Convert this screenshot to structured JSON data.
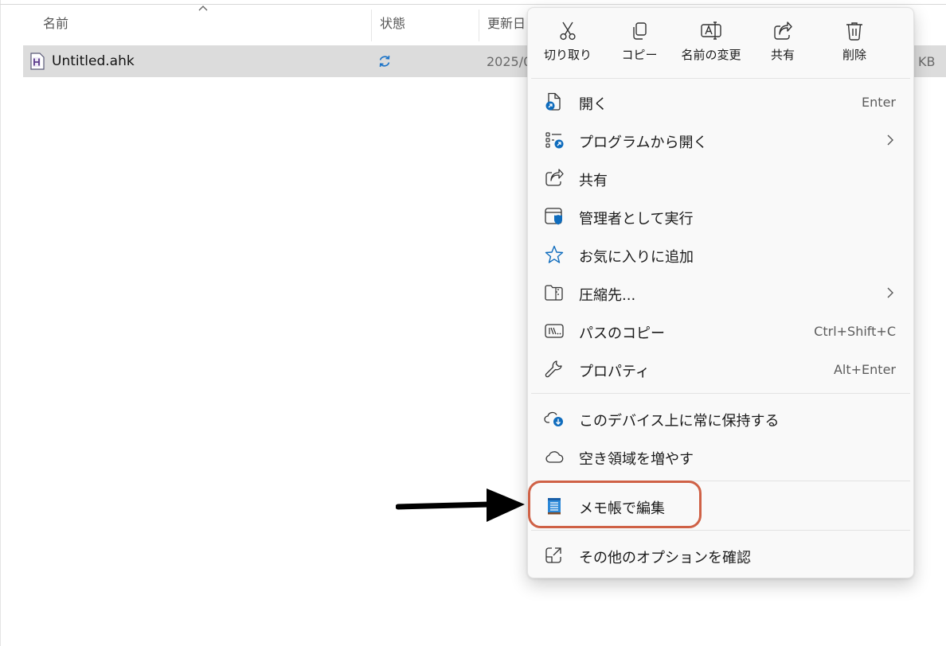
{
  "header": {
    "columns": [
      "名前",
      "状態",
      "更新日"
    ]
  },
  "file": {
    "name": "Untitled.ahk",
    "date_partial": "2025/0",
    "size_partial": "KB"
  },
  "menu": {
    "quick_actions": [
      {
        "label": "切り取り",
        "icon": "scissors-icon"
      },
      {
        "label": "コピー",
        "icon": "copy-icon"
      },
      {
        "label": "名前の変更",
        "icon": "rename-icon"
      },
      {
        "label": "共有",
        "icon": "share-icon"
      },
      {
        "label": "削除",
        "icon": "trash-icon"
      }
    ],
    "items": [
      {
        "label": "開く",
        "shortcut": "Enter",
        "icon": "open-file-icon"
      },
      {
        "label": "プログラムから開く",
        "shortcut": "",
        "icon": "open-with-icon",
        "submenu": true
      },
      {
        "label": "共有",
        "shortcut": "",
        "icon": "share-icon"
      },
      {
        "label": "管理者として実行",
        "shortcut": "",
        "icon": "admin-shield-icon"
      },
      {
        "label": "お気に入りに追加",
        "shortcut": "",
        "icon": "star-icon"
      },
      {
        "label": "圧縮先...",
        "shortcut": "",
        "icon": "zip-folder-icon",
        "submenu": true
      },
      {
        "label": "パスのコピー",
        "shortcut": "Ctrl+Shift+C",
        "icon": "copy-path-icon"
      },
      {
        "label": "プロパティ",
        "shortcut": "Alt+Enter",
        "icon": "wrench-icon"
      },
      {
        "label": "このデバイス上に常に保持する",
        "shortcut": "",
        "icon": "cloud-download-icon"
      },
      {
        "label": "空き領域を増やす",
        "shortcut": "",
        "icon": "cloud-icon"
      },
      {
        "label": "メモ帳で編集",
        "shortcut": "",
        "icon": "notepad-icon"
      },
      {
        "label": "その他のオプションを確認",
        "shortcut": "",
        "icon": "more-options-icon"
      }
    ]
  },
  "colors": {
    "accent_blue": "#0f6cbd",
    "highlight_border": "#cf6146",
    "selected_row": "#dcdcdc"
  }
}
